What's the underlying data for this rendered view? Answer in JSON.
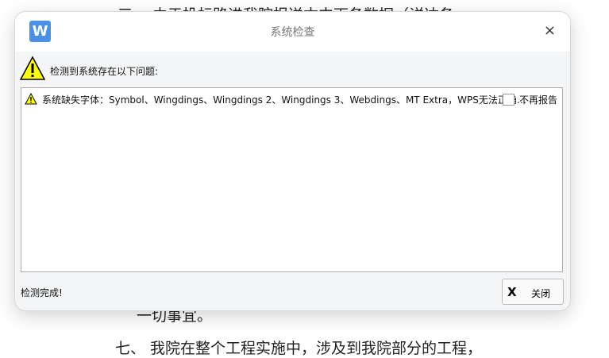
{
  "background_doc": {
    "line1": "三、  由于投标路进我院报送本中下各数据（详达各",
    "line2": "一切事宜。",
    "line3": "七、  我院在整个工程实施中，涉及到我院部分的工程，"
  },
  "dialog": {
    "logo": "W",
    "title": "系统检查",
    "close_icon": "×",
    "header": "检测到系统存在以下问题:",
    "issues": [
      {
        "message": "系统缺失字体：Symbol、Wingdings、Wingdings 2、Wingdings 3、Webdings、MT Extra，WPS无法正确…",
        "checkbox_label": "不再报告",
        "checked": false
      }
    ],
    "status": "检测完成!",
    "close_button": "关闭",
    "close_button_icon": "X"
  }
}
